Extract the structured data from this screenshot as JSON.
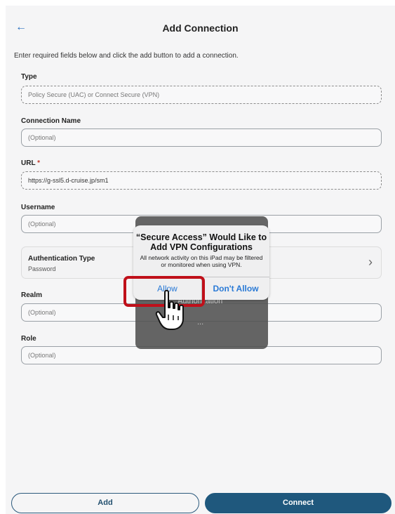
{
  "header": {
    "title": "Add Connection",
    "back_icon": "arrow-left-icon"
  },
  "intro": "Enter required fields below and click the add button to add a connection.",
  "form": {
    "type": {
      "label": "Type",
      "value": "Policy Secure (UAC) or Connect Secure (VPN)"
    },
    "connection_name": {
      "label": "Connection Name",
      "placeholder": "(Optional)"
    },
    "url": {
      "label": "URL",
      "required_mark": "*",
      "value": "https://g-ssl5.d-cruise.jp/sm1"
    },
    "username": {
      "label": "Username",
      "placeholder": "(Optional)"
    },
    "auth_type": {
      "label": "Authentication Type",
      "value": "Password",
      "chevron": "›"
    },
    "realm": {
      "label": "Realm",
      "placeholder": "(Optional)"
    },
    "role": {
      "label": "Role",
      "placeholder": "(Optional)"
    }
  },
  "buttons": {
    "add": "Add",
    "connect": "Connect"
  },
  "hud": {
    "text": "Authorization",
    "dots": "..."
  },
  "alert": {
    "title": "“Secure Access” Would Like to Add VPN Configurations",
    "message": "All network activity on this iPad may be filtered or monitored when using VPN.",
    "allow": "Allow",
    "dont_allow": "Don't Allow"
  },
  "colors": {
    "accent": "#1f587d",
    "highlight": "#c0101a",
    "link": "#2a7ad6"
  }
}
